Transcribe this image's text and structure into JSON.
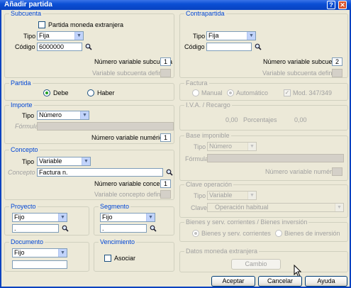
{
  "window": {
    "title": "Añadir partida",
    "help_btn": "?",
    "close_btn": "✕"
  },
  "subcuenta": {
    "legend": "Subcuenta",
    "moneda_label": "Partida moneda extranjera",
    "tipo_label": "Tipo",
    "tipo_value": "Fija",
    "codigo_label": "Código",
    "codigo_value": "6000000",
    "numvar_label": "Número variable subcuenta",
    "numvar_value": "1",
    "vardef_label": "Variable subcuenta definida"
  },
  "contrapartida": {
    "legend": "Contrapartida",
    "tipo_label": "Tipo",
    "tipo_value": "Fija",
    "codigo_label": "Código",
    "codigo_value": "",
    "numvar_label": "Número variable subcuenta",
    "numvar_value": "2",
    "vardef_label": "Variable subcuenta definida"
  },
  "partida": {
    "legend": "Partida",
    "debe": "Debe",
    "haber": "Haber"
  },
  "factura": {
    "legend": "Factura",
    "manual": "Manual",
    "automatico": "Automático",
    "mod": "Mod. 347/349"
  },
  "importe": {
    "legend": "Importe",
    "tipo_label": "Tipo",
    "tipo_value": "Número",
    "formula_label": "Fórmula",
    "numvar_label": "Número variable numérica",
    "numvar_value": "1"
  },
  "iva": {
    "legend": "I.V.A. / Recargo",
    "left_value": "0,00",
    "porcentajes": "Porcentajes",
    "right_value": "0,00"
  },
  "concepto": {
    "legend": "Concepto",
    "tipo_label": "Tipo",
    "tipo_value": "Variable",
    "concepto_label": "Concepto",
    "concepto_value": "Factura n.",
    "numvar_label": "Número variable concepto",
    "numvar_value": "1",
    "vardef_label": "Variable concepto definida"
  },
  "base": {
    "legend": "Base imponible",
    "tipo_label": "Tipo",
    "tipo_value": "Número",
    "formula_label": "Fórmula",
    "numvar_label": "Número variable numérica"
  },
  "clave": {
    "legend": "Clave operación",
    "tipo_label": "Tipo",
    "tipo_value": "Variable",
    "clave_label": "Clave",
    "clave_value": "Operación habitual"
  },
  "proyecto": {
    "legend": "Proyecto",
    "tipo_value": "Fijo",
    "code_value": "."
  },
  "segmento": {
    "legend": "Segmento",
    "tipo_value": "Fijo",
    "code_value": "."
  },
  "documento": {
    "legend": "Documento",
    "tipo_value": "Fijo",
    "value": ""
  },
  "vencimiento": {
    "legend": "Vencimiento",
    "asociar": "Asociar"
  },
  "bienes": {
    "legend": "Bienes y serv. corrientes / Bienes inversión",
    "corrientes": "Bienes y serv. corrientes",
    "inversion": "Bienes de inversión"
  },
  "datos": {
    "legend": "Datos moneda extranjera",
    "cambio": "Cambio"
  },
  "buttons": {
    "aceptar": "Aceptar",
    "cancelar": "Cancelar",
    "ayuda": "Ayuda"
  }
}
